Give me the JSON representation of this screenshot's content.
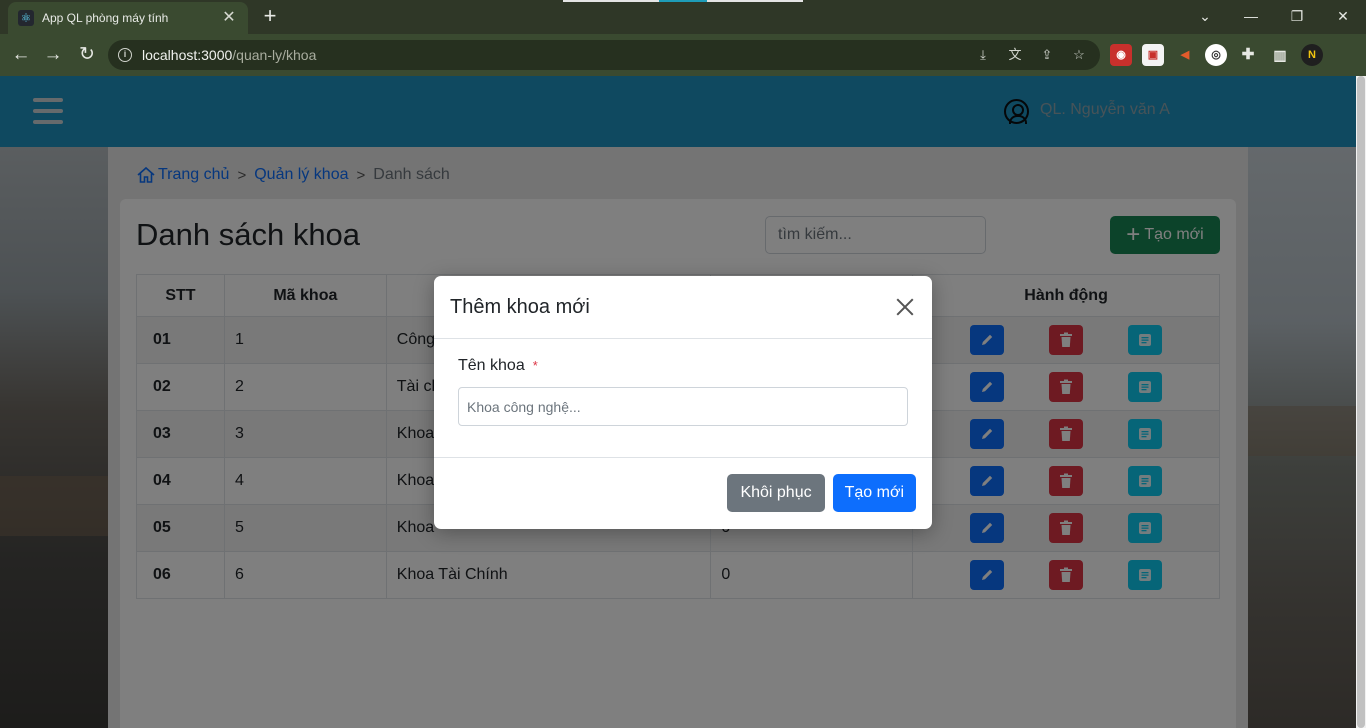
{
  "browser": {
    "tab_title": "App QL phòng máy tính",
    "url_host": "localhost:3000",
    "url_path": "/quan-ly/khoa",
    "new_tab": "+",
    "close_tab": "✕"
  },
  "header": {
    "user_name": "QL. Nguyễn văn A"
  },
  "breadcrumb": {
    "home": "Trang chủ",
    "section": "Quản lý khoa",
    "current": "Danh sách"
  },
  "main": {
    "title": "Danh sách khoa",
    "search_placeholder": "tìm kiếm...",
    "create_label": "Tạo mới",
    "columns": [
      "STT",
      "Mã khoa",
      "",
      "",
      "Hành động"
    ],
    "rows": [
      {
        "stt": "01",
        "ma": "1",
        "ten": "Công",
        "count": ""
      },
      {
        "stt": "02",
        "ma": "2",
        "ten": "Tài ch",
        "count": ""
      },
      {
        "stt": "03",
        "ma": "3",
        "ten": "Khoa",
        "count": ""
      },
      {
        "stt": "04",
        "ma": "4",
        "ten": "Khoa",
        "count": ""
      },
      {
        "stt": "05",
        "ma": "5",
        "ten": "Khoa",
        "count": "0"
      },
      {
        "stt": "06",
        "ma": "6",
        "ten": "Khoa Tài Chính",
        "count": "0"
      }
    ]
  },
  "modal": {
    "title": "Thêm khoa mới",
    "field_label": "Tên khoa",
    "required_mark": "*",
    "input_placeholder": "Khoa công nghệ...",
    "reset_label": "Khôi phục",
    "submit_label": "Tạo mới"
  },
  "colors": {
    "navbar": "#1e93c0",
    "primary": "#0d6efd",
    "danger": "#dc3545",
    "info": "#0dcaf0",
    "success": "#198754",
    "secondary": "#6c757d"
  }
}
